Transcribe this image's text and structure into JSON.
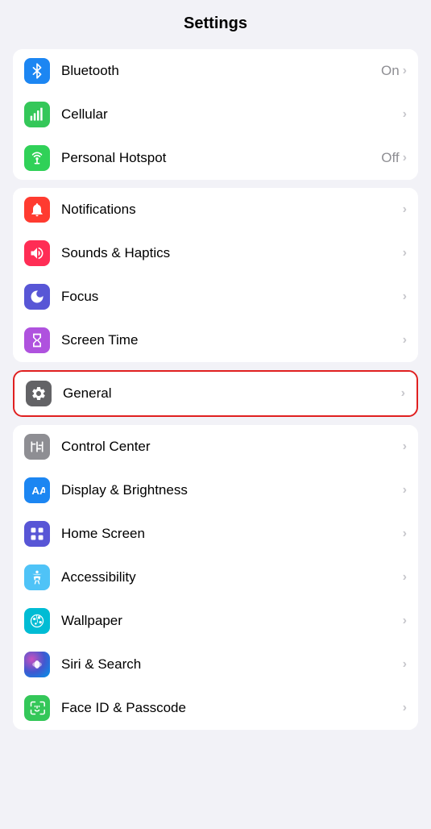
{
  "header": {
    "title": "Settings"
  },
  "sections": [
    {
      "id": "network",
      "rows": [
        {
          "id": "bluetooth",
          "label": "Bluetooth",
          "value": "On",
          "icon_bg": "bg-blue",
          "icon": "bluetooth",
          "partial": true
        },
        {
          "id": "cellular",
          "label": "Cellular",
          "value": "",
          "icon_bg": "bg-green",
          "icon": "cellular"
        },
        {
          "id": "personal-hotspot",
          "label": "Personal Hotspot",
          "value": "Off",
          "icon_bg": "bg-green2",
          "icon": "hotspot"
        }
      ]
    },
    {
      "id": "notifications",
      "rows": [
        {
          "id": "notifications",
          "label": "Notifications",
          "value": "",
          "icon_bg": "bg-red",
          "icon": "bell"
        },
        {
          "id": "sounds-haptics",
          "label": "Sounds & Haptics",
          "value": "",
          "icon_bg": "bg-pink",
          "icon": "speaker"
        },
        {
          "id": "focus",
          "label": "Focus",
          "value": "",
          "icon_bg": "bg-indigo",
          "icon": "moon"
        },
        {
          "id": "screen-time",
          "label": "Screen Time",
          "value": "",
          "icon_bg": "bg-purple2",
          "icon": "hourglass"
        }
      ]
    },
    {
      "id": "general-section",
      "highlighted": "general",
      "rows": [
        {
          "id": "general",
          "label": "General",
          "value": "",
          "icon_bg": "bg-gray2",
          "icon": "gear"
        }
      ]
    },
    {
      "id": "display-section",
      "rows": [
        {
          "id": "control-center",
          "label": "Control Center",
          "value": "",
          "icon_bg": "bg-gray",
          "icon": "sliders"
        },
        {
          "id": "display-brightness",
          "label": "Display & Brightness",
          "value": "",
          "icon_bg": "bg-blue",
          "icon": "display"
        },
        {
          "id": "home-screen",
          "label": "Home Screen",
          "value": "",
          "icon_bg": "bg-indigo",
          "icon": "homescreen"
        },
        {
          "id": "accessibility",
          "label": "Accessibility",
          "value": "",
          "icon_bg": "bg-lightblue",
          "icon": "accessibility"
        },
        {
          "id": "wallpaper",
          "label": "Wallpaper",
          "value": "",
          "icon_bg": "bg-cyan",
          "icon": "wallpaper"
        },
        {
          "id": "siri-search",
          "label": "Siri & Search",
          "value": "",
          "icon_bg": "bg-siri",
          "icon": "siri"
        },
        {
          "id": "faceid-passcode",
          "label": "Face ID & Passcode",
          "value": "",
          "icon_bg": "bg-green",
          "icon": "faceid"
        }
      ]
    }
  ]
}
